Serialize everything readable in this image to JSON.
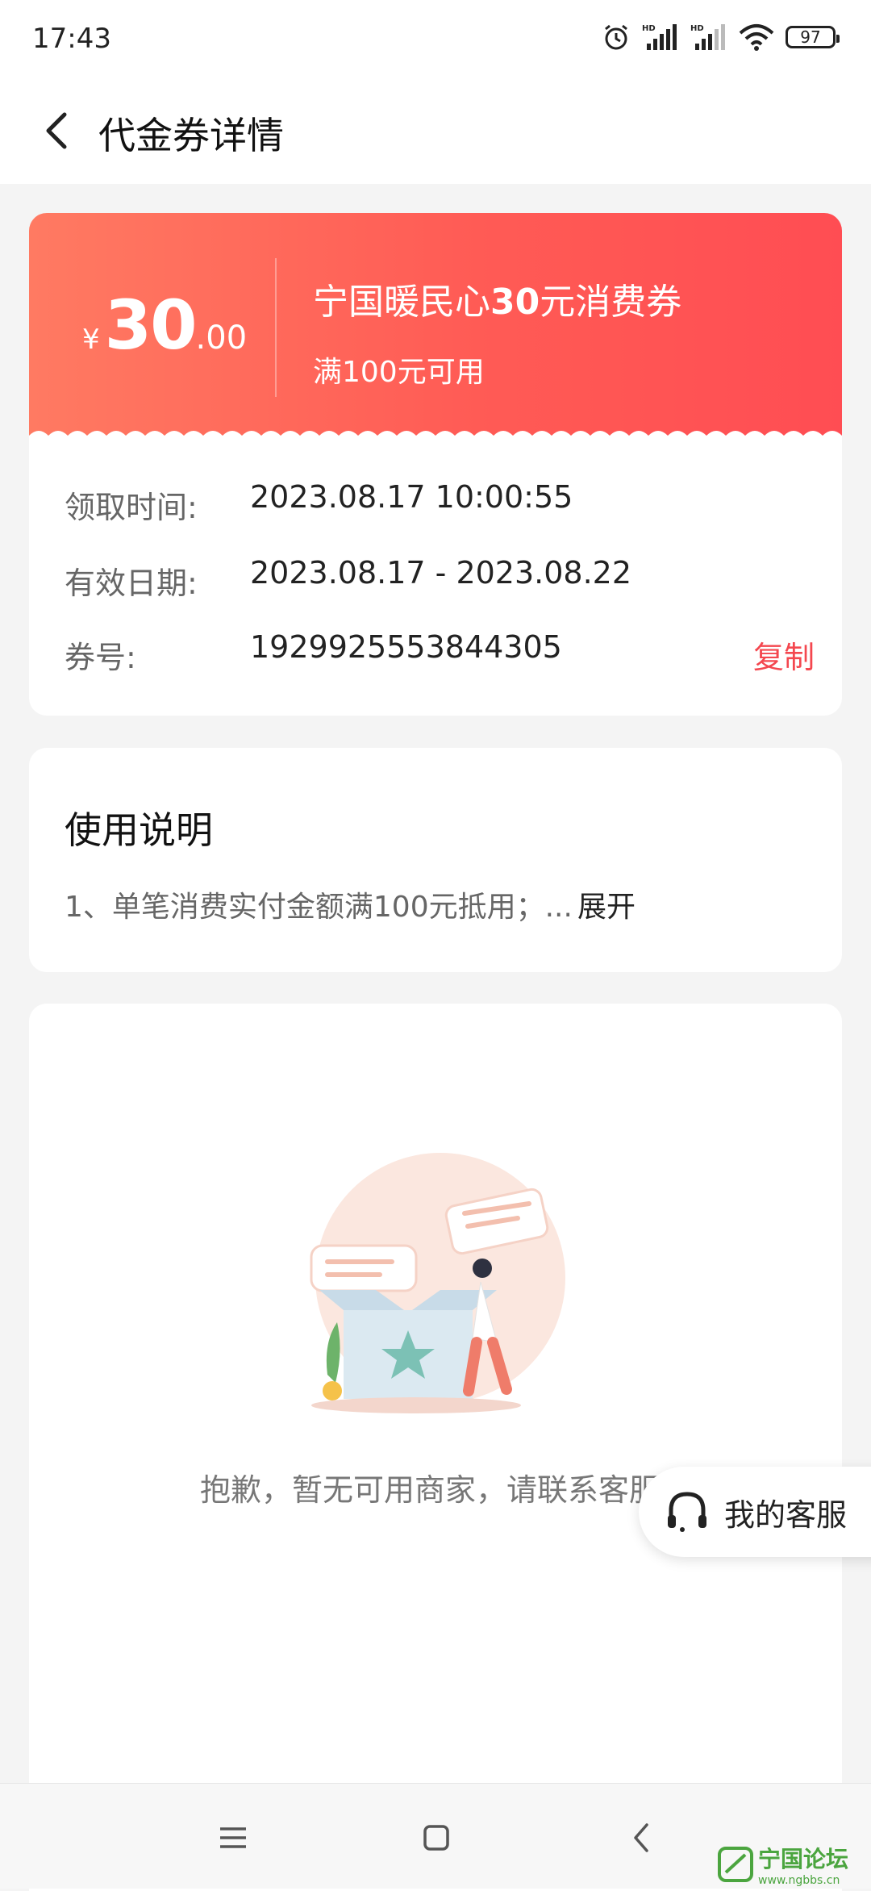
{
  "status_bar": {
    "time": "17:43",
    "battery": "97",
    "icons": [
      "alarm-icon",
      "hd-signal-icon",
      "hd-signal-icon",
      "wifi-icon",
      "battery-icon"
    ]
  },
  "header": {
    "title": "代金券详情",
    "back_icon": "chevron-left-icon"
  },
  "voucher": {
    "currency_symbol": "¥",
    "amount_integer": "30",
    "amount_decimal": ".00",
    "name_prefix": "宁国暖民心",
    "name_amount": "30",
    "name_suffix": "元消费券",
    "condition": "满100元可用",
    "claim_label": "领取时间:",
    "claim_time": "2023.08.17 10:00:55",
    "valid_label": "有效日期:",
    "valid_range": "2023.08.17 - 2023.08.22",
    "code_label": "券号:",
    "code": "1929925553844305",
    "copy_label": "复制"
  },
  "usage": {
    "title": "使用说明",
    "description": "1、单笔消费实付金额满100元抵用；...",
    "expand_label": "展开"
  },
  "merchants": {
    "empty_text": "抱歉，暂无可用商家，请联系客服",
    "illustration_icon": "empty-box-illustration"
  },
  "service_button": {
    "label": "我的客服",
    "icon": "headset-icon"
  },
  "nav_bar": {
    "items": [
      "menu-icon",
      "home-icon",
      "back-icon"
    ]
  },
  "watermark": {
    "title": "宁国论坛",
    "url": "www.ngbbs.cn"
  },
  "colors": {
    "voucher_gradient_start": "#ff7a62",
    "voucher_gradient_end": "#ff4d53",
    "accent_red": "#f4474f",
    "watermark_green": "#4ba53f"
  }
}
